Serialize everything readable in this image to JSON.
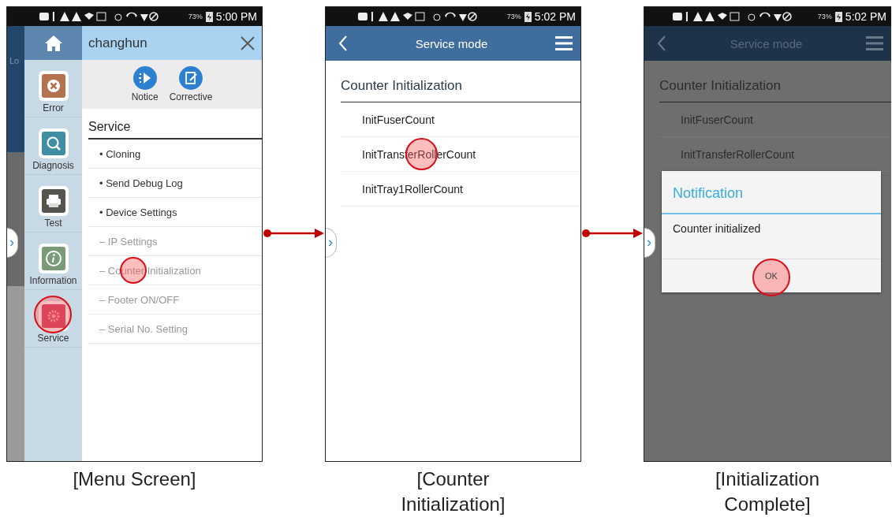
{
  "screens": [
    {
      "kind": "menu",
      "status_bar": {
        "battery": "73%",
        "time": "5:00 PM"
      },
      "background_text": "Lo",
      "edge_tab": "›",
      "user": "changhun",
      "sidebar": [
        {
          "label": "Error",
          "touched": false
        },
        {
          "label": "Diagnosis",
          "touched": false
        },
        {
          "label": "Test",
          "touched": false
        },
        {
          "label": "Information",
          "touched": false
        },
        {
          "label": "Service",
          "touched": true
        }
      ],
      "actions": [
        {
          "label": "Notice"
        },
        {
          "label": "Corrective"
        }
      ],
      "section": "Service",
      "items": [
        {
          "kind": "main",
          "marker": "•",
          "label": "Cloning",
          "touched": false
        },
        {
          "kind": "main",
          "marker": "•",
          "label": "Send Debug Log",
          "touched": false
        },
        {
          "kind": "main",
          "marker": "•",
          "label": "Device Settings",
          "touched": false
        },
        {
          "kind": "sub",
          "marker": "–",
          "label": "IP Settings",
          "touched": false
        },
        {
          "kind": "sub",
          "marker": "–",
          "label": "Counter Initialization",
          "touched": true
        },
        {
          "kind": "sub",
          "marker": "–",
          "label": "Footer ON/OFF",
          "touched": false
        },
        {
          "kind": "sub",
          "marker": "–",
          "label": "Serial No. Setting",
          "touched": false
        }
      ],
      "caption": "[Menu Screen]"
    },
    {
      "kind": "list",
      "dimmed": false,
      "status_bar": {
        "battery": "73%",
        "time": "5:02 PM"
      },
      "edge_tab": "›",
      "title": "Service mode",
      "heading": "Counter Initialization",
      "rows": [
        {
          "label": "InitFuserCount",
          "touched": false
        },
        {
          "label": "InitTransferRollerCount",
          "touched": true
        },
        {
          "label": "InitTray1RollerCount",
          "touched": false
        }
      ],
      "caption": "[Counter Initialization]"
    },
    {
      "kind": "list",
      "dimmed": true,
      "status_bar": {
        "battery": "73%",
        "time": "5:02 PM"
      },
      "edge_tab": "›",
      "title": "Service mode",
      "heading": "Counter Initialization",
      "rows": [
        {
          "label": "InitFuserCount",
          "touched": false
        },
        {
          "label": "InitTransferRollerCount",
          "touched": false
        }
      ],
      "dialog": {
        "title": "Notification",
        "message": "Counter initialized",
        "button": {
          "label": "OK",
          "touched": true
        }
      },
      "caption": "[Initialization Complete]"
    }
  ]
}
